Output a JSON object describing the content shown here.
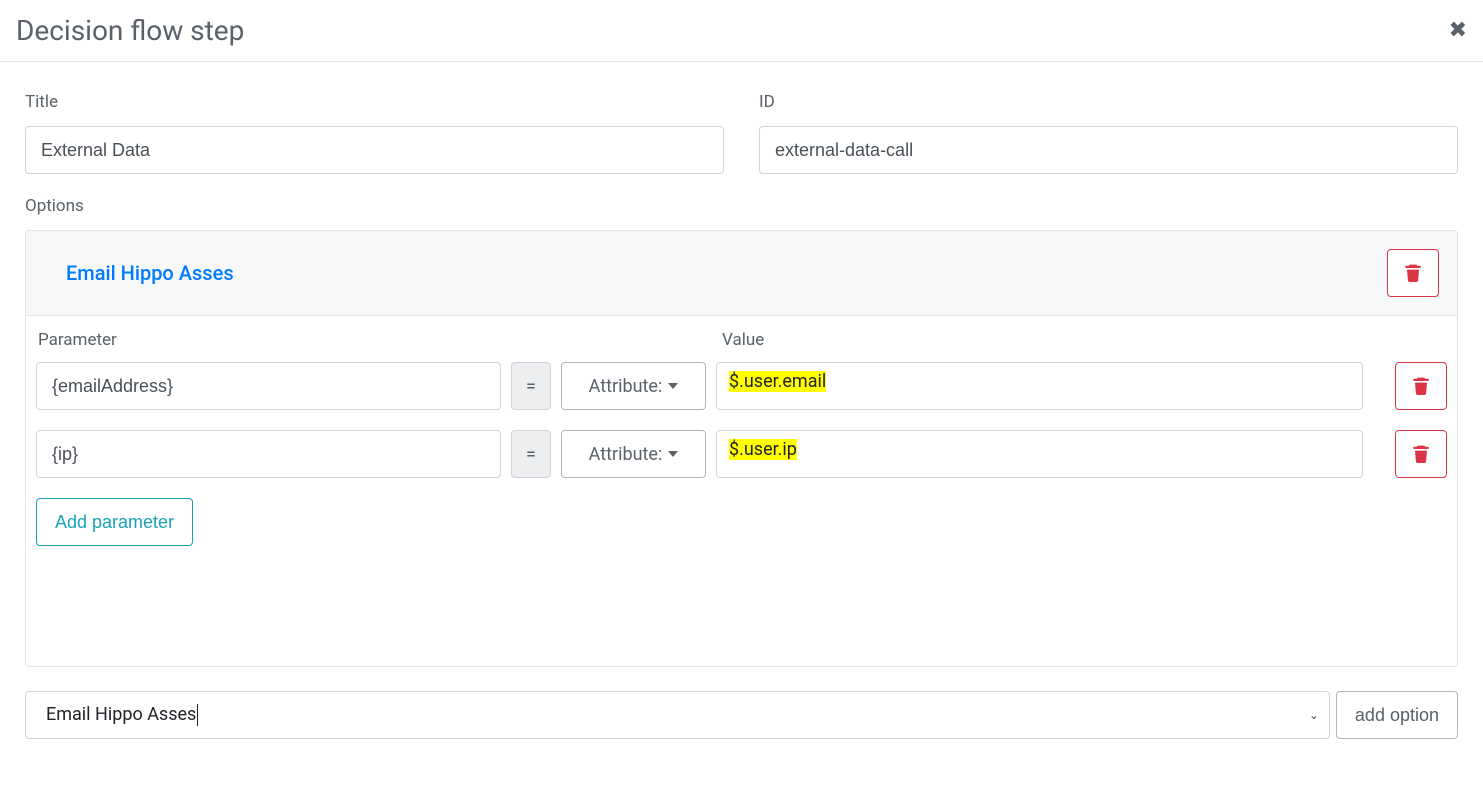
{
  "header": {
    "title": "Decision flow step"
  },
  "fields": {
    "title_label": "Title",
    "title_value": "External Data",
    "id_label": "ID",
    "id_value": "external-data-call"
  },
  "options": {
    "label": "Options",
    "option_name": "Email Hippo Asses",
    "parameter_label": "Parameter",
    "value_label": "Value",
    "equals": "=",
    "attribute_label": "Attribute:",
    "rows": [
      {
        "param": "{emailAddress}",
        "value": "$.user.email"
      },
      {
        "param": "{ip}",
        "value": "$.user.ip"
      }
    ],
    "add_parameter": "Add parameter"
  },
  "footer_select": {
    "value": "Email Hippo Asses",
    "add_option": "add option"
  }
}
